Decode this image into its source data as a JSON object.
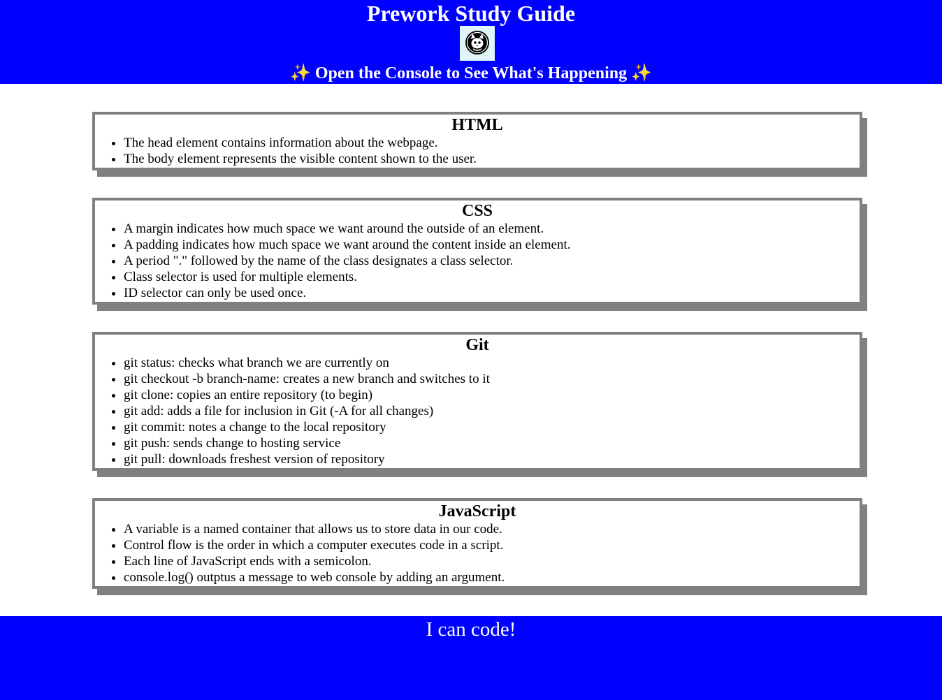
{
  "header": {
    "title": "Prework Study Guide",
    "logo_icon": "cat-face-icon",
    "subtitle_sparkle_left": "✨",
    "subtitle_text": "Open the Console to See What's Happening",
    "subtitle_sparkle_right": "✨"
  },
  "sections": [
    {
      "title": "HTML",
      "items": [
        "The head element contains information about the webpage.",
        "The body element represents the visible content shown to the user."
      ]
    },
    {
      "title": "CSS",
      "items": [
        "A margin indicates how much space we want around the outside of an element.",
        "A padding indicates how much space we want around the content inside an element.",
        "A period \".\" followed by the name of the class designates a class selector.",
        "Class selector is used for multiple elements.",
        "ID selector can only be used once."
      ]
    },
    {
      "title": "Git",
      "items": [
        "git status: checks what branch we are currently on",
        "git checkout -b branch-name: creates a new branch and switches to it",
        "git clone: copies an entire repository (to begin)",
        "git add: adds a file for inclusion in Git (-A for all changes)",
        "git commit: notes a change to the local repository",
        "git push: sends change to hosting service",
        "git pull: downloads freshest version of repository"
      ]
    },
    {
      "title": "JavaScript",
      "items": [
        "A variable is a named container that allows us to store data in our code.",
        "Control flow is the order in which a computer executes code in a script.",
        "Each line of JavaScript ends with a semicolon.",
        "console.log() outptus a message to web console by adding an argument."
      ]
    }
  ],
  "footer": {
    "tagline": "I can code!"
  },
  "colors": {
    "header_bg": "#0000ff",
    "footer_bg": "#0000ff",
    "card_border": "#808080",
    "logo_bg": "#dff5f8"
  }
}
